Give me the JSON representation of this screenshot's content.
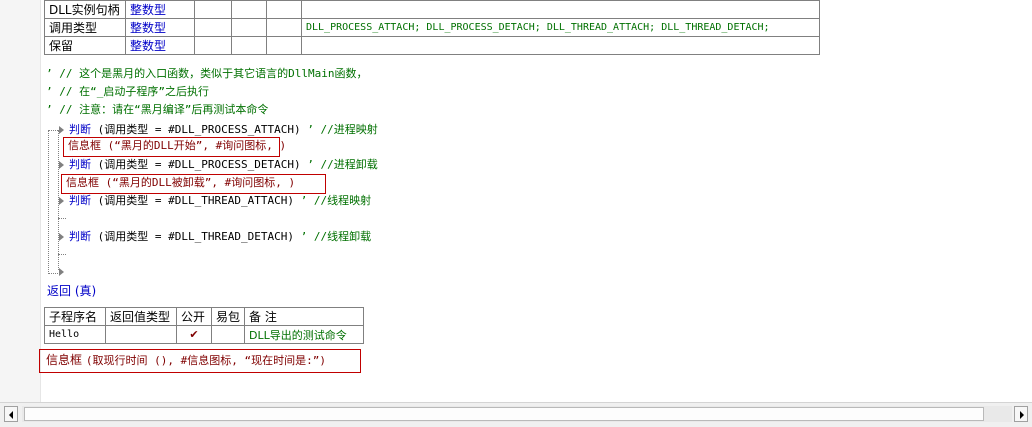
{
  "params_table": {
    "rows": [
      {
        "name": "DLL实例句柄",
        "type": "整数型",
        "note": ""
      },
      {
        "name": "调用类型",
        "type": "整数型",
        "note": "DLL_PROCESS_ATTACH; DLL_PROCESS_DETACH; DLL_THREAD_ATTACH; DLL_THREAD_DETACH;"
      },
      {
        "name": "保留",
        "type": "整数型",
        "note": ""
      }
    ]
  },
  "comments": [
    "’ // 这个是黑月的入口函数，类似于其它语言的DllMain函数，",
    "’ // 在“_启动子程序”之后执行",
    "’ // 注意：请在“黑月编译”后再测试本命令"
  ],
  "code": {
    "if1_kw": "判断",
    "if1_cond": "(调用类型 = #DLL_PROCESS_ATTACH)",
    "if1_comment": "’ //进程映射",
    "msg1": "信息框 (“黑月的DLL开始”, #询问图标, )",
    "if2_kw": "判断",
    "if2_cond": "(调用类型 = #DLL_PROCESS_DETACH)",
    "if2_comment": "’ //进程卸载",
    "msg2": "信息框 (“黑月的DLL被卸载”, #询问图标, )",
    "if3_kw": "判断",
    "if3_cond": "(调用类型 = #DLL_THREAD_ATTACH)",
    "if3_comment": "’ //线程映射",
    "if4_kw": "判断",
    "if4_cond": "(调用类型 = #DLL_THREAD_DETACH)",
    "if4_comment": "’ //线程卸载",
    "return": "返回 (真)"
  },
  "sub_table": {
    "headers": [
      "子程序名",
      "返回值类型",
      "公开",
      "易包",
      "备 注"
    ],
    "row": {
      "name": "Hello",
      "ret": "",
      "public_mark": "✔",
      "epkg": "",
      "note": "DLL导出的测试命令"
    }
  },
  "bottom_msg": {
    "kw": "信息框",
    "rest": "(取现行时间 (), #信息图标, “现在时间是:”)"
  },
  "colors": {
    "keyword": "#0000c8",
    "comment": "#007000",
    "highlight_box": "#c00000",
    "check": "#800000"
  }
}
